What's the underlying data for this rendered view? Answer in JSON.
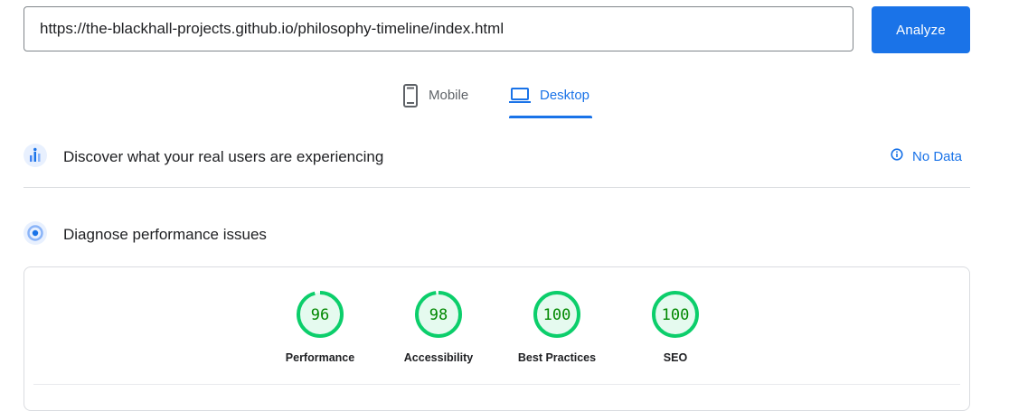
{
  "search": {
    "url": "https://the-blackhall-projects.github.io/philosophy-timeline/index.html"
  },
  "analyze_label": "Analyze",
  "tabs": [
    {
      "label": "Mobile",
      "icon": "phone-icon",
      "active": false
    },
    {
      "label": "Desktop",
      "icon": "laptop-icon",
      "active": true
    }
  ],
  "crux": {
    "title": "Discover what your real users are experiencing",
    "status": "No Data",
    "icon": "users-chart-icon"
  },
  "diagnose": {
    "title": "Diagnose performance issues",
    "icon": "gauge-icon"
  },
  "scores": [
    {
      "label": "Performance",
      "score": 96,
      "value": "96"
    },
    {
      "label": "Accessibility",
      "score": 98,
      "value": "98"
    },
    {
      "label": "Best Practices",
      "score": 100,
      "value": "100"
    },
    {
      "label": "SEO",
      "score": 100,
      "value": "100"
    }
  ],
  "colors": {
    "accent": "#1a73e8",
    "pass": "#0cce6b",
    "pass_fill": "#e5faef",
    "pass_text": "#008800"
  }
}
